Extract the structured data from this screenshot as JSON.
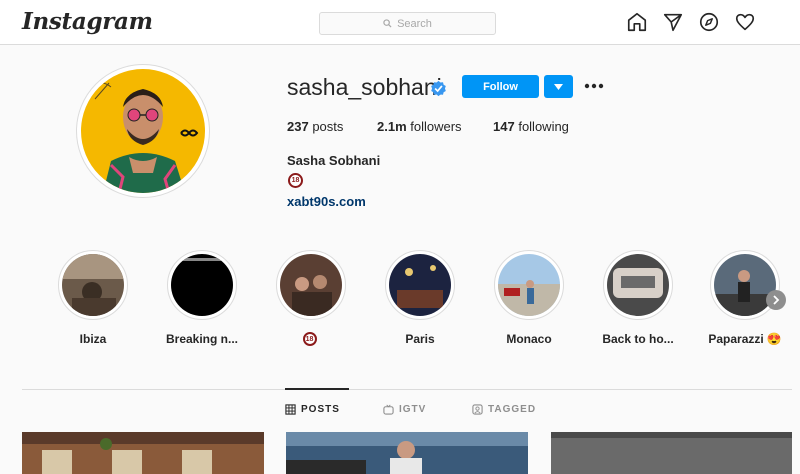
{
  "app": {
    "logo": "Instagram"
  },
  "search": {
    "placeholder": "Search"
  },
  "nav": {
    "icons": [
      "home-icon",
      "direct-icon",
      "explore-icon",
      "activity-heart-icon"
    ]
  },
  "profile": {
    "username": "sasha_sobhani",
    "verified": true,
    "follow_label": "Follow",
    "posts_count": "237",
    "posts_label": "posts",
    "followers_count": "2.1m",
    "followers_label": "followers",
    "following_count": "147",
    "following_label": "following",
    "full_name": "Sasha Sobhani",
    "bio_badge": "18",
    "website": "xabt90s.com"
  },
  "highlights": [
    {
      "label": "Ibiza"
    },
    {
      "label": "Breaking n..."
    },
    {
      "label": "",
      "badge": "18"
    },
    {
      "label": "Paris"
    },
    {
      "label": "Monaco"
    },
    {
      "label": "Back to ho..."
    },
    {
      "label": "Paparazzi",
      "emoji": "😍"
    }
  ],
  "tabs": [
    {
      "label": "POSTS",
      "active": true
    },
    {
      "label": "IGTV",
      "active": false
    },
    {
      "label": "TAGGED",
      "active": false
    }
  ],
  "colors": {
    "primary_button": "#0095f6",
    "link": "#00376b",
    "avatar_bg": "#f5b800"
  }
}
